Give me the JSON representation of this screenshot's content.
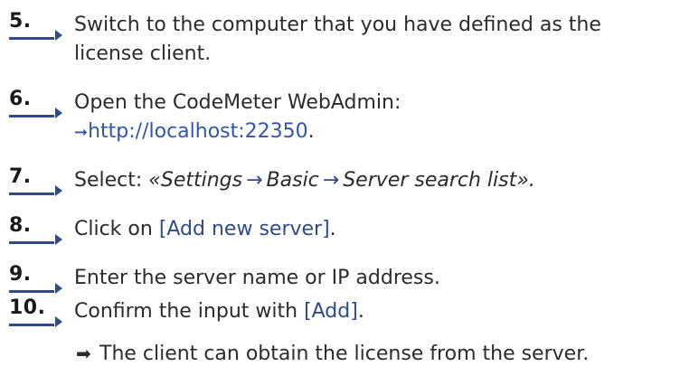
{
  "steps": [
    {
      "number": "5.",
      "line1": "Switch to the computer that you have defined as the",
      "line2": "license client."
    },
    {
      "number": "6.",
      "line1": "Open the CodeMeter WebAdmin:",
      "link": "http://localhost:22350",
      "link_suffix": "."
    },
    {
      "number": "7.",
      "prefix": "Select: ",
      "path_open": "«",
      "path": [
        "Settings",
        "Basic",
        "Server search list"
      ],
      "path_close": "».",
      "separator": "→"
    },
    {
      "number": "8.",
      "prefix": "Click on ",
      "button": "[Add new server]",
      "suffix": "."
    },
    {
      "number": "9.",
      "line1": "Enter the server name or IP address."
    },
    {
      "number": "10.",
      "prefix": "Confirm the input with ",
      "button": "[Add]",
      "suffix": "."
    }
  ],
  "result": {
    "icon": "right-arrow-icon",
    "text": "The client can obtain the license from the server."
  },
  "colors": {
    "accent": "#2f4b8c",
    "link": "#3256a8",
    "text": "#2b2b2b"
  }
}
